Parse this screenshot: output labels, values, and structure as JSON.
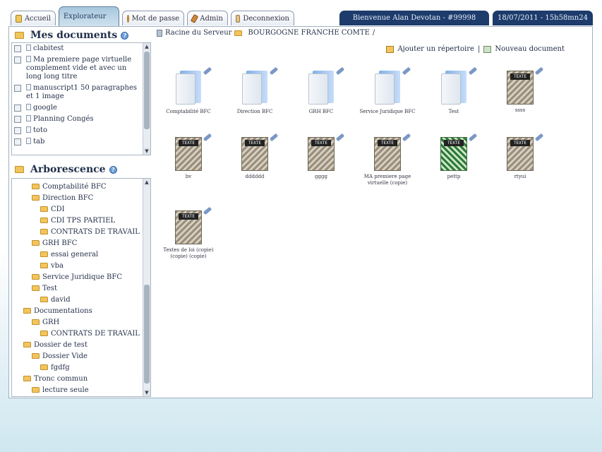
{
  "tabs": [
    {
      "label": "Accueil",
      "icon": "home-icon",
      "active": false
    },
    {
      "label": "Explorateur",
      "icon": "",
      "active": true
    },
    {
      "label": "Mot de passe",
      "icon": "key-icon",
      "active": false
    },
    {
      "label": "Admin",
      "icon": "tool-icon",
      "active": false
    },
    {
      "label": "Deconnexion",
      "icon": "disconnect-icon",
      "active": false
    }
  ],
  "welcome_text": "Bienvenue Alan Devotan - #99998",
  "datetime_text": "18/07/2011 - 15h58mn24",
  "mes_documents": {
    "title": "Mes documents",
    "items": [
      "clabitest",
      "Ma premiere page virtuelle complement vide et avec un long long titre",
      "manuscript1 50 paragraphes et 1 image",
      "google",
      "Planning Congés",
      "toto",
      "tab"
    ]
  },
  "arborescence": {
    "title": "Arborescence",
    "items": [
      {
        "label": "Comptabilité BFC",
        "level": 2
      },
      {
        "label": "Direction BFC",
        "level": 2
      },
      {
        "label": "CDI",
        "level": 3
      },
      {
        "label": "CDI TPS PARTIEL",
        "level": 3
      },
      {
        "label": "CONTRATS DE TRAVAIL",
        "level": 3
      },
      {
        "label": "GRH BFC",
        "level": 2
      },
      {
        "label": "essai general",
        "level": 3
      },
      {
        "label": "vba",
        "level": 3
      },
      {
        "label": "Service Juridique BFC",
        "level": 2
      },
      {
        "label": "Test",
        "level": 2
      },
      {
        "label": "david",
        "level": 3
      },
      {
        "label": "Documentations",
        "level": 1
      },
      {
        "label": "GRH",
        "level": 2
      },
      {
        "label": "CONTRATS DE TRAVAIL",
        "level": 3
      },
      {
        "label": "Dossier de test",
        "level": 1
      },
      {
        "label": "Dossier Vide",
        "level": 2
      },
      {
        "label": "fgdfg",
        "level": 3
      },
      {
        "label": "Tronc commun",
        "level": 1
      },
      {
        "label": "lecture seule",
        "level": 2
      }
    ]
  },
  "breadcrumb": {
    "root": "Racine du Serveur",
    "current": "BOURGOGNE FRANCHE COMTE"
  },
  "actions": {
    "add_folder": "Ajouter un répertoire",
    "separator": "|",
    "new_document": "Nouveau document"
  },
  "items": [
    {
      "label": "Comptabilité BFC",
      "type": "folder"
    },
    {
      "label": "Direction BFC",
      "type": "folder"
    },
    {
      "label": "GRH BFC",
      "type": "folder"
    },
    {
      "label": "Service Juridique BFC",
      "type": "folder"
    },
    {
      "label": "Test",
      "type": "folder"
    },
    {
      "label": "ssss",
      "type": "text"
    },
    {
      "label": "bv",
      "type": "text"
    },
    {
      "label": "dddddd",
      "type": "text"
    },
    {
      "label": "gggg",
      "type": "text"
    },
    {
      "label": "MA premiere page virtuelle (copie)",
      "type": "text"
    },
    {
      "label": "pettp",
      "type": "excel"
    },
    {
      "label": "rtyui",
      "type": "text"
    },
    {
      "label": "Textes de loi (copie) (copie) (copie)",
      "type": "text"
    }
  ],
  "file_tag": "TEXTE"
}
